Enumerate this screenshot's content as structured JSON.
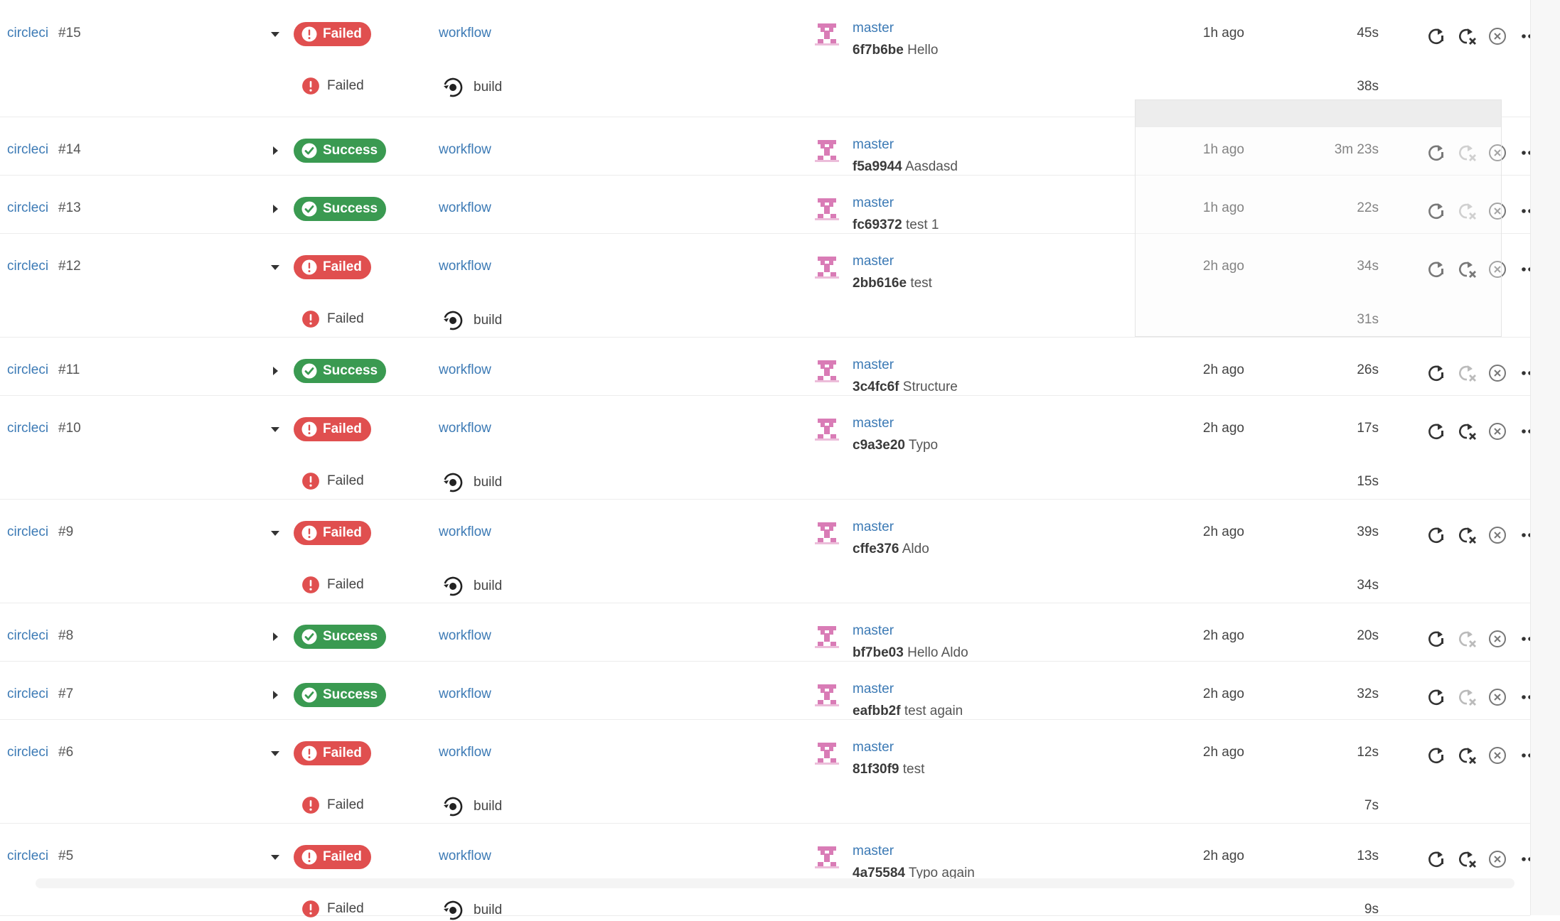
{
  "colors": {
    "failed": "#e04f4f",
    "success": "#3a9a51",
    "link": "#3c7ab5",
    "avatar": "#d97cb6"
  },
  "pipelines": [
    {
      "project": "circleci",
      "number": "#15",
      "expanded": true,
      "status": "Failed",
      "workflow": "workflow",
      "branch": "master",
      "hash": "6f7b6be",
      "message": "Hello",
      "started": "1h ago",
      "duration": "45s",
      "job": {
        "status": "Failed",
        "name": "build",
        "duration": "38s"
      }
    },
    {
      "project": "circleci",
      "number": "#14",
      "expanded": false,
      "status": "Success",
      "workflow": "workflow",
      "branch": "master",
      "hash": "f5a9944",
      "message": "Aasdasd",
      "started": "1h ago",
      "duration": "3m 23s"
    },
    {
      "project": "circleci",
      "number": "#13",
      "expanded": false,
      "status": "Success",
      "workflow": "workflow",
      "branch": "master",
      "hash": "fc69372",
      "message": "test 1",
      "started": "1h ago",
      "duration": "22s"
    },
    {
      "project": "circleci",
      "number": "#12",
      "expanded": true,
      "status": "Failed",
      "workflow": "workflow",
      "branch": "master",
      "hash": "2bb616e",
      "message": "test",
      "started": "2h ago",
      "duration": "34s",
      "job": {
        "status": "Failed",
        "name": "build",
        "duration": "31s"
      }
    },
    {
      "project": "circleci",
      "number": "#11",
      "expanded": false,
      "status": "Success",
      "workflow": "workflow",
      "branch": "master",
      "hash": "3c4fc6f",
      "message": "Structure",
      "started": "2h ago",
      "duration": "26s"
    },
    {
      "project": "circleci",
      "number": "#10",
      "expanded": true,
      "status": "Failed",
      "workflow": "workflow",
      "branch": "master",
      "hash": "c9a3e20",
      "message": "Typo",
      "started": "2h ago",
      "duration": "17s",
      "job": {
        "status": "Failed",
        "name": "build",
        "duration": "15s"
      }
    },
    {
      "project": "circleci",
      "number": "#9",
      "expanded": true,
      "status": "Failed",
      "workflow": "workflow",
      "branch": "master",
      "hash": "cffe376",
      "message": "Aldo",
      "started": "2h ago",
      "duration": "39s",
      "job": {
        "status": "Failed",
        "name": "build",
        "duration": "34s"
      }
    },
    {
      "project": "circleci",
      "number": "#8",
      "expanded": false,
      "status": "Success",
      "workflow": "workflow",
      "branch": "master",
      "hash": "bf7be03",
      "message": "Hello Aldo",
      "started": "2h ago",
      "duration": "20s"
    },
    {
      "project": "circleci",
      "number": "#7",
      "expanded": false,
      "status": "Success",
      "workflow": "workflow",
      "branch": "master",
      "hash": "eafbb2f",
      "message": "test again",
      "started": "2h ago",
      "duration": "32s"
    },
    {
      "project": "circleci",
      "number": "#6",
      "expanded": true,
      "status": "Failed",
      "workflow": "workflow",
      "branch": "master",
      "hash": "81f30f9",
      "message": "test",
      "started": "2h ago",
      "duration": "12s",
      "job": {
        "status": "Failed",
        "name": "build",
        "duration": "7s"
      }
    },
    {
      "project": "circleci",
      "number": "#5",
      "expanded": true,
      "status": "Failed",
      "workflow": "workflow",
      "branch": "master",
      "hash": "4a75584",
      "message": "Typo again",
      "started": "2h ago",
      "duration": "13s",
      "job": {
        "status": "Failed",
        "name": "build",
        "duration": "9s"
      }
    }
  ],
  "icons": {
    "rerun": "rerun-icon",
    "rerun_failed": "rerun-failed-icon",
    "cancel": "cancel-icon",
    "more": "more-icon",
    "expand": "chevron-right-icon",
    "collapse": "chevron-down-icon",
    "job": "job-icon",
    "avatar": "avatar-icon"
  }
}
